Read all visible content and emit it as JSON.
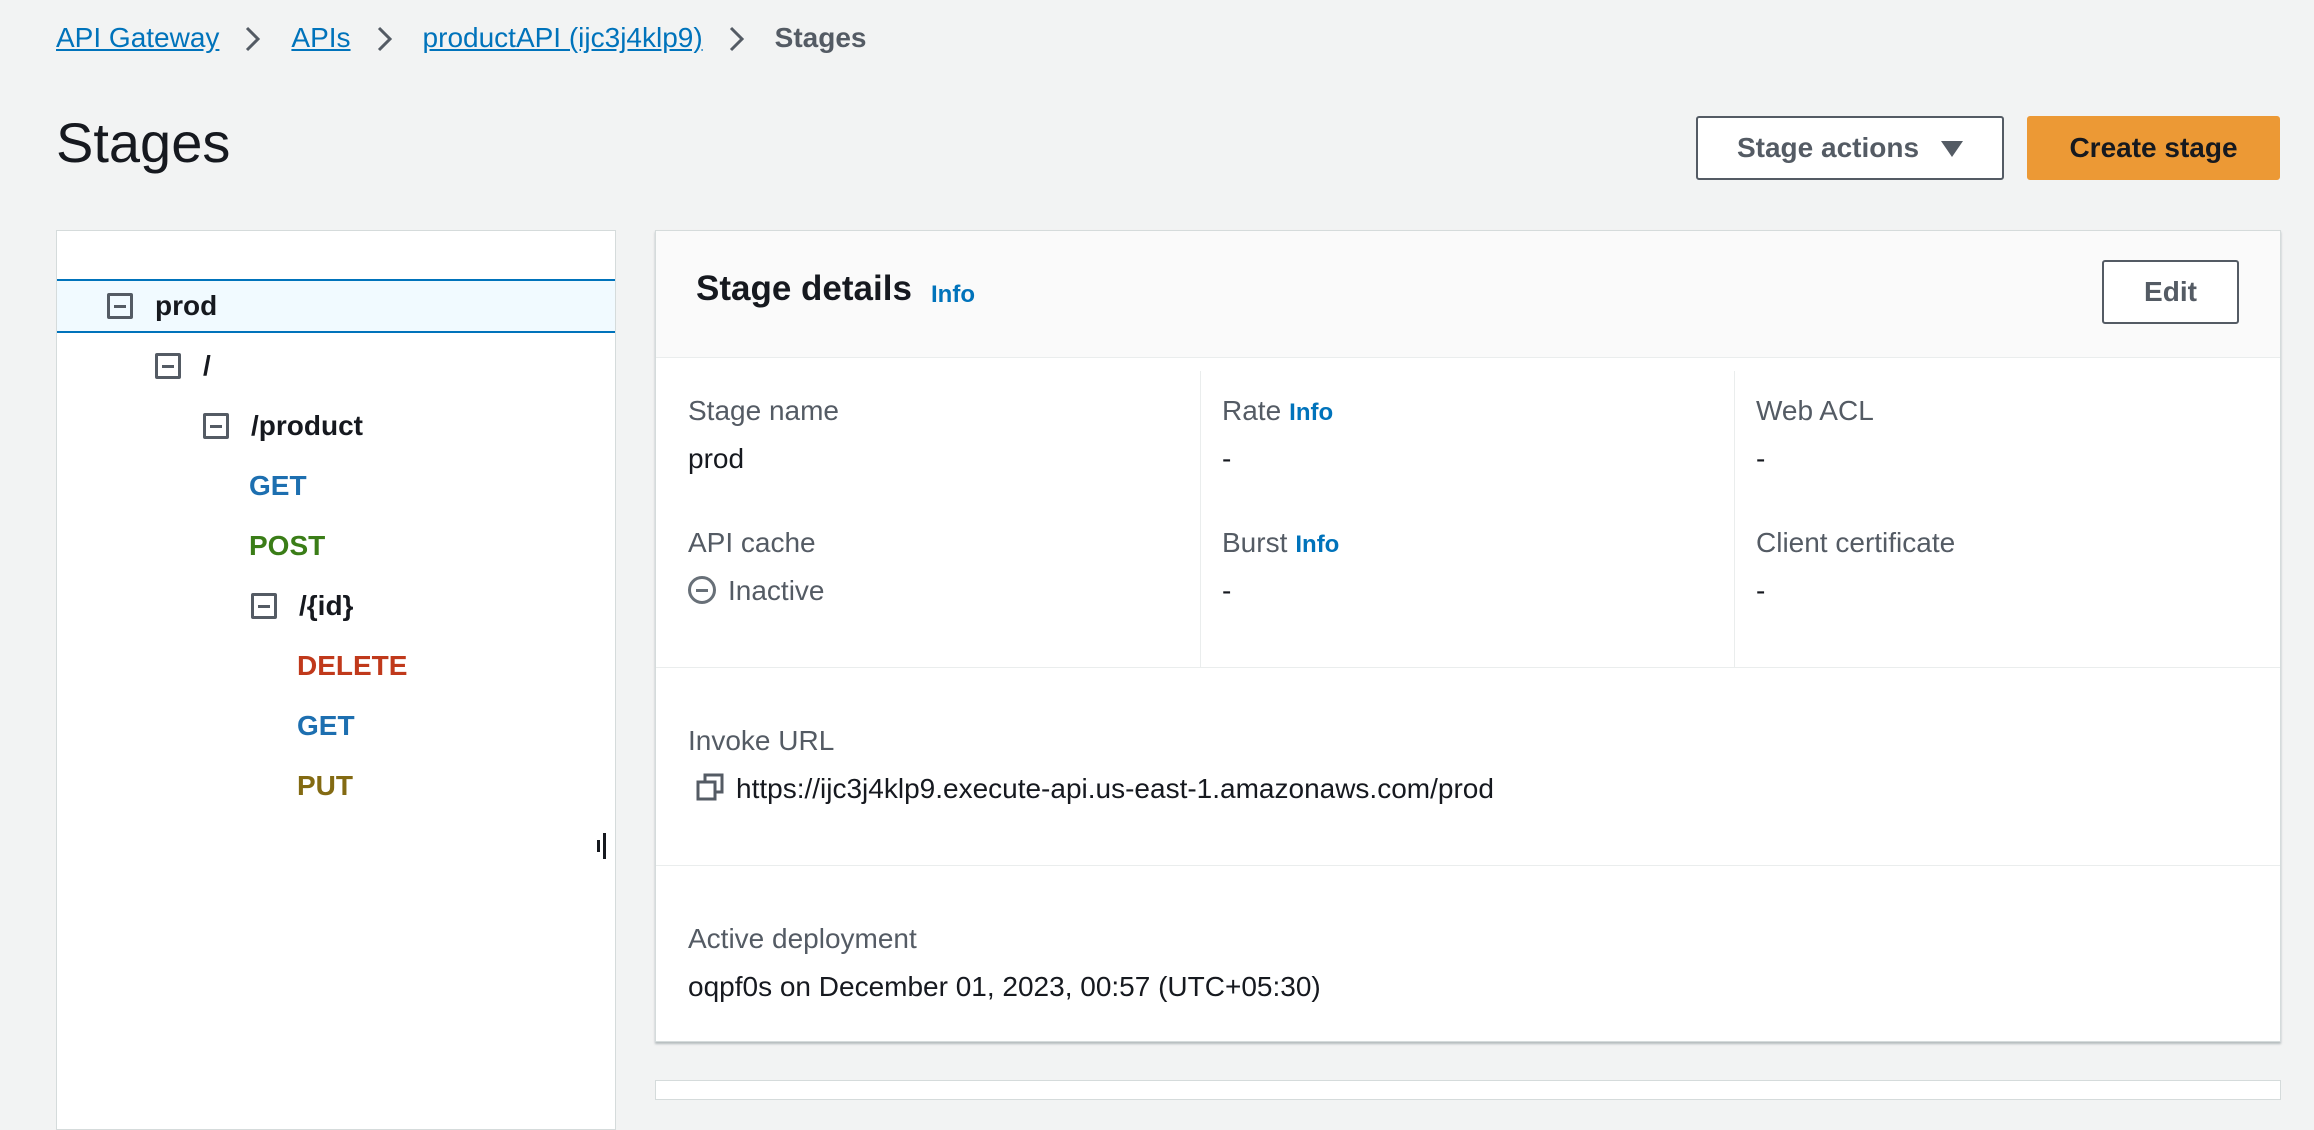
{
  "breadcrumb": {
    "items": [
      "API Gateway",
      "APIs",
      "productAPI (ijc3j4klp9)"
    ],
    "current": "Stages"
  },
  "header": {
    "title": "Stages",
    "stage_actions_label": "Stage actions",
    "create_stage_label": "Create stage"
  },
  "tree": {
    "stage": "prod",
    "root": "/",
    "product": "/product",
    "product_methods": [
      "GET",
      "POST"
    ],
    "id_resource": "/{id}",
    "id_methods": [
      "DELETE",
      "GET",
      "PUT"
    ]
  },
  "details": {
    "title": "Stage details",
    "info": "Info",
    "edit_label": "Edit",
    "stage_name_label": "Stage name",
    "stage_name_value": "prod",
    "rate_label": "Rate",
    "rate_value": "-",
    "web_acl_label": "Web ACL",
    "web_acl_value": "-",
    "api_cache_label": "API cache",
    "api_cache_value": "Inactive",
    "burst_label": "Burst",
    "burst_value": "-",
    "client_cert_label": "Client certificate",
    "client_cert_value": "-",
    "invoke_url_label": "Invoke URL",
    "invoke_url_value": "https://ijc3j4klp9.execute-api.us-east-1.amazonaws.com/prod",
    "active_deployment_label": "Active deployment",
    "active_deployment_value": "oqpf0s on December 01, 2023, 00:57 (UTC+05:30)"
  },
  "colors": {
    "link": "#0073bb",
    "primary_button": "#ec9935",
    "method_get": "#1d6fb0",
    "method_post": "#3a7d17",
    "method_delete": "#c0391b",
    "method_put": "#836a12"
  },
  "icons": [
    "chevron-right-icon",
    "caret-down-icon",
    "collapse-icon",
    "status-inactive-icon",
    "copy-icon",
    "resize-handle-icon"
  ]
}
